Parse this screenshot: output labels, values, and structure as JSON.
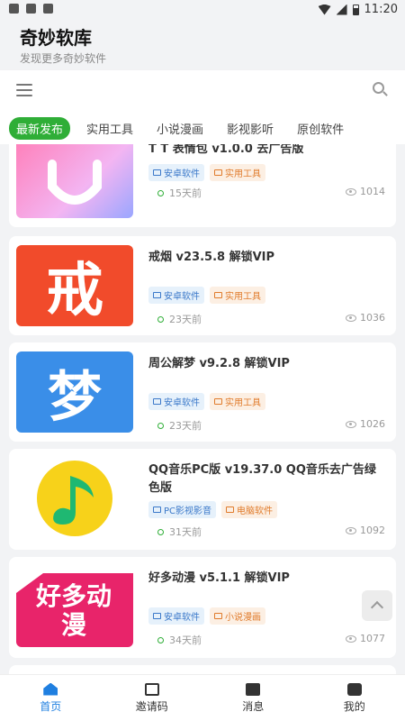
{
  "status_bar": {
    "time": "11:20"
  },
  "app": {
    "title": "奇妙软库",
    "subtitle": "发现更多奇妙软件"
  },
  "tabs": [
    {
      "label": "最新发布"
    },
    {
      "label": "实用工具"
    },
    {
      "label": "小说漫画"
    },
    {
      "label": "影视影听"
    },
    {
      "label": "原创软件"
    }
  ],
  "cards": [
    {
      "title": "T T 表情包 v1.0.0 去广告版",
      "tag1": "安卓软件",
      "tag2": "实用工具",
      "time": "15天前",
      "views": "1014",
      "thumb_text": ""
    },
    {
      "title": "戒烟 v23.5.8 解锁VIP",
      "tag1": "安卓软件",
      "tag2": "实用工具",
      "time": "23天前",
      "views": "1036",
      "thumb_text": "戒"
    },
    {
      "title": "周公解梦 v9.2.8 解锁VIP",
      "tag1": "安卓软件",
      "tag2": "实用工具",
      "time": "23天前",
      "views": "1026",
      "thumb_text": "梦"
    },
    {
      "title": "QQ音乐PC版 v19.37.0 QQ音乐去广告绿色版",
      "tag1": "PC影视影音",
      "tag2": "电脑软件",
      "time": "31天前",
      "views": "1092",
      "thumb_text": ""
    },
    {
      "title": "好多动漫 v5.1.1 解锁VIP",
      "tag1": "安卓软件",
      "tag2": "小说漫画",
      "time": "34天前",
      "views": "1077",
      "thumb_text": "好多动漫"
    }
  ],
  "nav": [
    {
      "label": "首页",
      "icon": "home-icon"
    },
    {
      "label": "邀请码",
      "icon": "invite-icon"
    },
    {
      "label": "消息",
      "icon": "message-icon"
    },
    {
      "label": "我的",
      "icon": "profile-icon"
    }
  ],
  "colors": {
    "accent": "#2fae37",
    "nav_active": "#1f7fe0"
  }
}
